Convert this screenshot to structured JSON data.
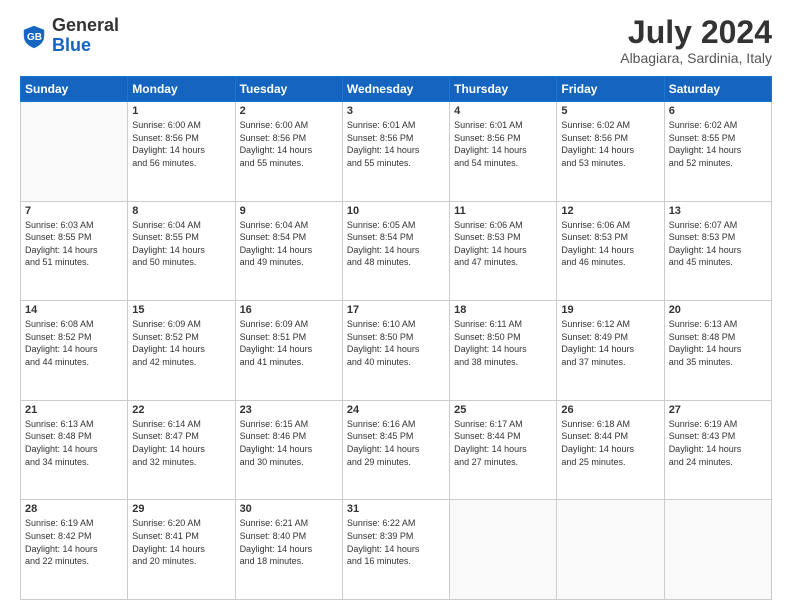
{
  "header": {
    "logo_general": "General",
    "logo_blue": "Blue",
    "month_year": "July 2024",
    "location": "Albagiara, Sardinia, Italy"
  },
  "calendar": {
    "days_of_week": [
      "Sunday",
      "Monday",
      "Tuesday",
      "Wednesday",
      "Thursday",
      "Friday",
      "Saturday"
    ],
    "weeks": [
      [
        {
          "day": "",
          "info": ""
        },
        {
          "day": "1",
          "info": "Sunrise: 6:00 AM\nSunset: 8:56 PM\nDaylight: 14 hours\nand 56 minutes."
        },
        {
          "day": "2",
          "info": "Sunrise: 6:00 AM\nSunset: 8:56 PM\nDaylight: 14 hours\nand 55 minutes."
        },
        {
          "day": "3",
          "info": "Sunrise: 6:01 AM\nSunset: 8:56 PM\nDaylight: 14 hours\nand 55 minutes."
        },
        {
          "day": "4",
          "info": "Sunrise: 6:01 AM\nSunset: 8:56 PM\nDaylight: 14 hours\nand 54 minutes."
        },
        {
          "day": "5",
          "info": "Sunrise: 6:02 AM\nSunset: 8:56 PM\nDaylight: 14 hours\nand 53 minutes."
        },
        {
          "day": "6",
          "info": "Sunrise: 6:02 AM\nSunset: 8:55 PM\nDaylight: 14 hours\nand 52 minutes."
        }
      ],
      [
        {
          "day": "7",
          "info": "Sunrise: 6:03 AM\nSunset: 8:55 PM\nDaylight: 14 hours\nand 51 minutes."
        },
        {
          "day": "8",
          "info": "Sunrise: 6:04 AM\nSunset: 8:55 PM\nDaylight: 14 hours\nand 50 minutes."
        },
        {
          "day": "9",
          "info": "Sunrise: 6:04 AM\nSunset: 8:54 PM\nDaylight: 14 hours\nand 49 minutes."
        },
        {
          "day": "10",
          "info": "Sunrise: 6:05 AM\nSunset: 8:54 PM\nDaylight: 14 hours\nand 48 minutes."
        },
        {
          "day": "11",
          "info": "Sunrise: 6:06 AM\nSunset: 8:53 PM\nDaylight: 14 hours\nand 47 minutes."
        },
        {
          "day": "12",
          "info": "Sunrise: 6:06 AM\nSunset: 8:53 PM\nDaylight: 14 hours\nand 46 minutes."
        },
        {
          "day": "13",
          "info": "Sunrise: 6:07 AM\nSunset: 8:53 PM\nDaylight: 14 hours\nand 45 minutes."
        }
      ],
      [
        {
          "day": "14",
          "info": "Sunrise: 6:08 AM\nSunset: 8:52 PM\nDaylight: 14 hours\nand 44 minutes."
        },
        {
          "day": "15",
          "info": "Sunrise: 6:09 AM\nSunset: 8:52 PM\nDaylight: 14 hours\nand 42 minutes."
        },
        {
          "day": "16",
          "info": "Sunrise: 6:09 AM\nSunset: 8:51 PM\nDaylight: 14 hours\nand 41 minutes."
        },
        {
          "day": "17",
          "info": "Sunrise: 6:10 AM\nSunset: 8:50 PM\nDaylight: 14 hours\nand 40 minutes."
        },
        {
          "day": "18",
          "info": "Sunrise: 6:11 AM\nSunset: 8:50 PM\nDaylight: 14 hours\nand 38 minutes."
        },
        {
          "day": "19",
          "info": "Sunrise: 6:12 AM\nSunset: 8:49 PM\nDaylight: 14 hours\nand 37 minutes."
        },
        {
          "day": "20",
          "info": "Sunrise: 6:13 AM\nSunset: 8:48 PM\nDaylight: 14 hours\nand 35 minutes."
        }
      ],
      [
        {
          "day": "21",
          "info": "Sunrise: 6:13 AM\nSunset: 8:48 PM\nDaylight: 14 hours\nand 34 minutes."
        },
        {
          "day": "22",
          "info": "Sunrise: 6:14 AM\nSunset: 8:47 PM\nDaylight: 14 hours\nand 32 minutes."
        },
        {
          "day": "23",
          "info": "Sunrise: 6:15 AM\nSunset: 8:46 PM\nDaylight: 14 hours\nand 30 minutes."
        },
        {
          "day": "24",
          "info": "Sunrise: 6:16 AM\nSunset: 8:45 PM\nDaylight: 14 hours\nand 29 minutes."
        },
        {
          "day": "25",
          "info": "Sunrise: 6:17 AM\nSunset: 8:44 PM\nDaylight: 14 hours\nand 27 minutes."
        },
        {
          "day": "26",
          "info": "Sunrise: 6:18 AM\nSunset: 8:44 PM\nDaylight: 14 hours\nand 25 minutes."
        },
        {
          "day": "27",
          "info": "Sunrise: 6:19 AM\nSunset: 8:43 PM\nDaylight: 14 hours\nand 24 minutes."
        }
      ],
      [
        {
          "day": "28",
          "info": "Sunrise: 6:19 AM\nSunset: 8:42 PM\nDaylight: 14 hours\nand 22 minutes."
        },
        {
          "day": "29",
          "info": "Sunrise: 6:20 AM\nSunset: 8:41 PM\nDaylight: 14 hours\nand 20 minutes."
        },
        {
          "day": "30",
          "info": "Sunrise: 6:21 AM\nSunset: 8:40 PM\nDaylight: 14 hours\nand 18 minutes."
        },
        {
          "day": "31",
          "info": "Sunrise: 6:22 AM\nSunset: 8:39 PM\nDaylight: 14 hours\nand 16 minutes."
        },
        {
          "day": "",
          "info": ""
        },
        {
          "day": "",
          "info": ""
        },
        {
          "day": "",
          "info": ""
        }
      ]
    ]
  }
}
